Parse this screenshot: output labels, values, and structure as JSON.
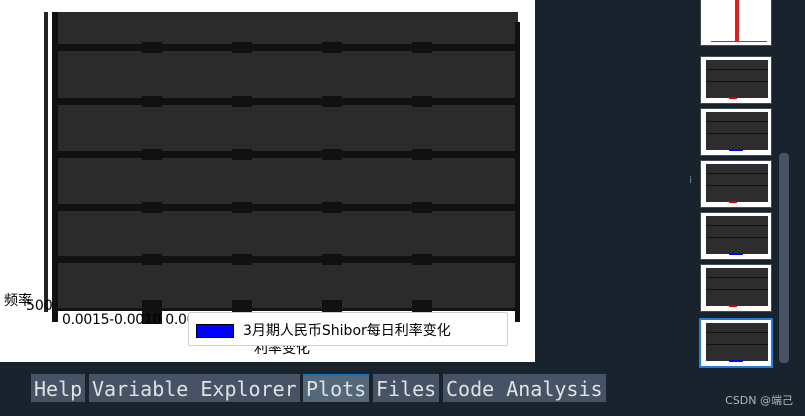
{
  "plot": {
    "ylabel": "频率",
    "ytick": "500",
    "xticks_overlapped": "0.0015-0.0010 0.0005 0.0000 0.0005 0.0015",
    "xlabel": "利率变化",
    "legend_label": "3月期人民币Shibor每日利率变化",
    "legend_color": "#0000ff"
  },
  "tabs": [
    {
      "label": "Help",
      "active": false
    },
    {
      "label": "Variable Explorer",
      "active": false
    },
    {
      "label": "Plots",
      "active": true
    },
    {
      "label": "Files",
      "active": false
    },
    {
      "label": "Code Analysis",
      "active": false
    }
  ],
  "watermark": "CSDN @端己",
  "colors": {
    "background": "#19232d",
    "tab": "#455364",
    "tab_active_border": "#1a72bb",
    "thumb_selected": "#2a7bd4"
  }
}
